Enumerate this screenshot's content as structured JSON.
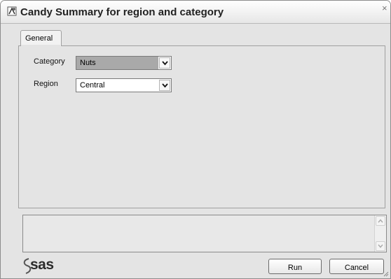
{
  "window": {
    "title": "Candy Summary for region and category",
    "close_glyph": "×",
    "title_icon": "sas-app-icon"
  },
  "tabs": [
    {
      "label": "General",
      "selected": true
    }
  ],
  "form": {
    "category": {
      "label": "Category",
      "value": "Nuts"
    },
    "region": {
      "label": "Region",
      "value": "Central"
    }
  },
  "status": {
    "text": ""
  },
  "footer": {
    "logo_text": "sas",
    "run_label": "Run",
    "cancel_label": "Cancel"
  }
}
